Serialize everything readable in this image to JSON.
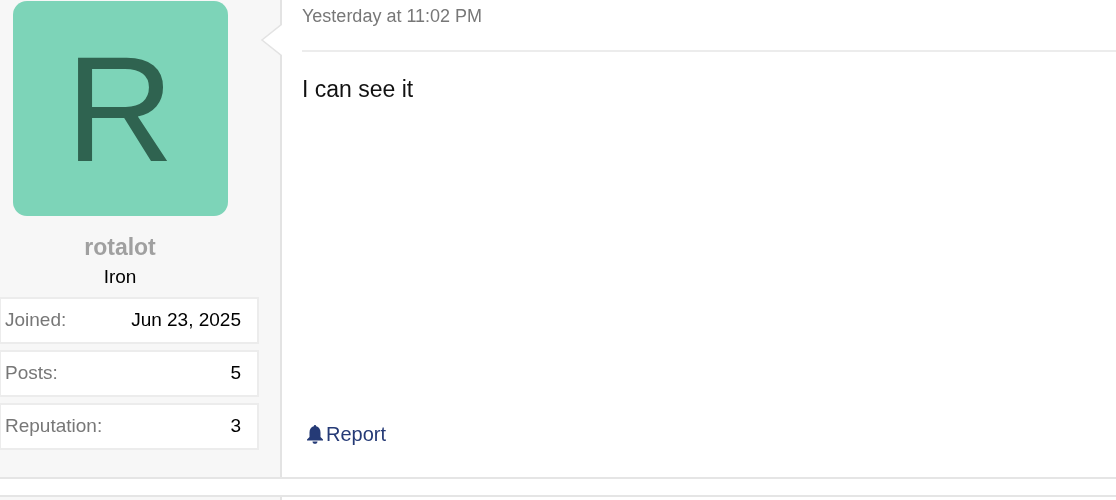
{
  "author": {
    "avatar_letter": "R",
    "username": "rotalot",
    "rank": "Iron"
  },
  "stats": [
    {
      "label": "Joined:",
      "value": "Jun 23, 2025"
    },
    {
      "label": "Posts:",
      "value": "5"
    },
    {
      "label": "Reputation:",
      "value": "3"
    }
  ],
  "post": {
    "timestamp": "Yesterday at 11:02 PM",
    "body": "I can see it",
    "actions": [
      "Report"
    ]
  }
}
